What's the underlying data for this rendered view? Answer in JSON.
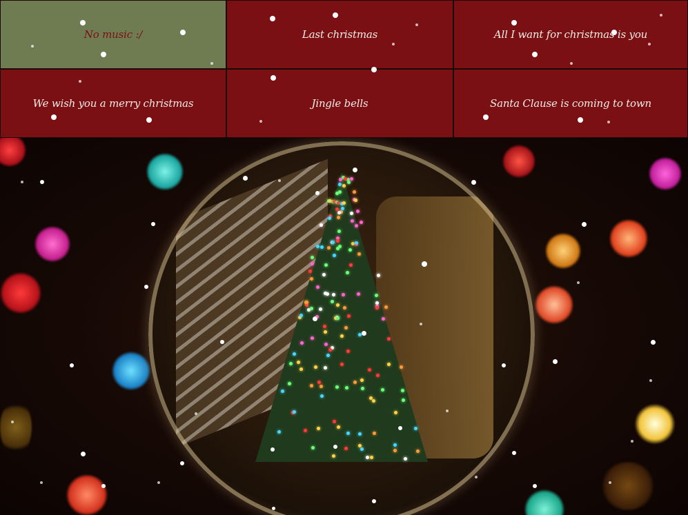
{
  "songs": [
    {
      "label": "No music :/",
      "muted": true
    },
    {
      "label": "Last christmas",
      "muted": false
    },
    {
      "label": "All I want for christmas is you",
      "muted": false
    },
    {
      "label": "We wish you a merry christmas",
      "muted": false
    },
    {
      "label": "Jingle bells",
      "muted": false
    },
    {
      "label": "Santa Clause is coming to town",
      "muted": false
    }
  ],
  "colors": {
    "button_red": "#7a0f14",
    "button_olive": "#6f7c52",
    "button_text": "#f6eee6"
  }
}
